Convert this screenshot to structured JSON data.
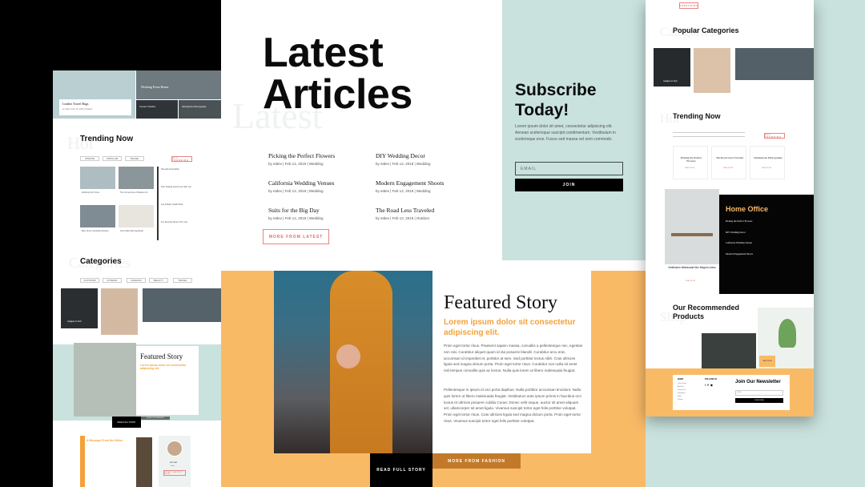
{
  "colors": {
    "background": "#000000",
    "mint": "#c9e2dd",
    "orange": "#f9ba66",
    "accent_text": "#f4a13a",
    "coral": "#e06b64",
    "dark": "#0b0b0b"
  },
  "center": {
    "title_line1": "Latest",
    "title_line2": "Articles",
    "ghost": "Latest",
    "articles": [
      {
        "title": "Picking the Perfect Flowers",
        "meta": "by etdev | Feb 12, 2019 | Wedding"
      },
      {
        "title": "DIY Wedding Decor",
        "meta": "by etdev | Feb 12, 2019 | Wedding"
      },
      {
        "title": "California Wedding Venues",
        "meta": "by etdev | Feb 12, 2019 | Wedding"
      },
      {
        "title": "Modern Engagement Shoots",
        "meta": "by etdev | Feb 12, 2019 | Wedding"
      },
      {
        "title": "Suits for the Big Day",
        "meta": "by etdev | Feb 12, 2019 | Wedding"
      },
      {
        "title": "The Road Less Traveled",
        "meta": "by etdev | Feb 12, 2019 | Outdoor"
      }
    ],
    "more_button": "MORE FROM LATEST"
  },
  "subscribe": {
    "title_line1": "Subscribe",
    "title_line2": "Today!",
    "body": "Lorem ipsum dolor sit amet, consectetur adipiscing elit. Aenean scelerisque suscipit condimentum. Vestibulum in scelerisque eros. Fusce sed massa vel sem commodo.",
    "email_placeholder": "EMAIL",
    "join": "JOIN"
  },
  "featured": {
    "title": "Featured Story",
    "subtitle": "Lorem ipsum dolor sit consectetur adipiscing elit.",
    "para1": "Proin eget tortor risus. Praesent sapien massa, convallis a pellentesque nec, egestas non nisi. Curabitur aliquet quam id dui posuere blandit. Curabitur arcu erat, accumsan id imperdiet et, porttitor at sem. Sed porttitor lectus nibh. Cras ultricies ligula sed magna dictum porta. Proin eget tortor risus. Curabitur non nulla sit amet nisl tempus convallis quis ac lectus. Nulla quis lorem ut libero malesuada feugiat.",
    "para2": "Pellentesque in ipsum id orci porta dapibus. Nulla porttitor accumsan tincidunt. Nulla quis lorem ut libero malesuada feugiat. Vestibulum ante ipsum primis in faucibus orci luctus et ultrices posuere cubilia Curae; Donec velit neque, auctor sit amet aliquam vel, ullamcorper sit amet ligula. Vivamus suscipit tortor eget felis porttitor volutpat. Proin eget tortor risus. Cras ultricies ligula sed magna dictum porta. Proin eget tortor risus. Vivamus suscipit tortor eget felis porttitor volutpat.",
    "read_button": "READ FULL STORY",
    "fashion_button": "MORE FROM FASHION"
  },
  "left": {
    "hero_card_title": "Leather Travel Bags",
    "hero_card_meta": "by etdev | Feb 12, 2019 | Outdoor",
    "hero_top_right": "Working From Home",
    "thumb1": "Sweater Weather",
    "thumb2": "Smartphone Photography",
    "trending_title": "Trending Now",
    "trending_ghost": "Hot",
    "chips": [
      "UPDATE",
      "POPULAR",
      "TRAVEL"
    ],
    "all_trending": "ALL TRENDING",
    "grid_items": [
      "Working from Home",
      "The Cornerstone of Modern Art",
      "Best Green Smoothie Recipes",
      "Life's Daily Morning Ritual"
    ],
    "list_items": [
      "Strength & Flexibility",
      "How Healing Foods Can Help You",
      "Gut & Brain Health Work",
      "Fun Running Shoes This Year"
    ],
    "categories_title": "Categories",
    "categories_ghost": "Categories",
    "cat_chips": [
      "OUTDOOR",
      "FITNESS",
      "FASHION",
      "BEAUTY",
      "TRAVEL"
    ],
    "cat_card_label": "Gadgets & Tech",
    "featured_title": "Featured Story",
    "featured_sub": "Lorem ipsum dolor sit consectetur adipiscing elit.",
    "read_btn": "READ FULL STORY",
    "fashion_btn": "MORE FROM FASHION",
    "message_title": "A Message From the Editor",
    "author_name": "Ann Gio",
    "author_role": "Editor",
    "about_btn": "READ ABOUT ANN"
  },
  "right": {
    "top_tag": "SUBSCRIBE",
    "categories_title": "Popular Categories",
    "categories_ghost": "Categories",
    "cat_label": "Gadgets & Tech",
    "trending_title": "Trending Now",
    "trending_ghost": "Hot",
    "all_trending": "ALL TRENDING",
    "trending_items": [
      "Picking the Perfect Flowers",
      "The Road Less Traveled",
      "Smartphone Photography"
    ],
    "read_more": "READ MORE",
    "office_title": "Home Office",
    "office_items": [
      "Picking the Perfect Flowers",
      "DIY Wedding Decor",
      "California Wedding Venues",
      "Modern Engagement Shoots"
    ],
    "office_caption": "Vestibulum Malesuada Nec Magna Lectus",
    "office_read": "READ MORE",
    "recommended_title_line1": "Our Recommended",
    "recommended_title_line2": "Products",
    "shop_now": "SHOP NOW",
    "footer_col1": "SHOP",
    "footer_col2": "FOLLOW US",
    "newsletter_title": "Join Our Newsletter",
    "newsletter_placeholder": "EMAIL",
    "newsletter_button": "SUBSCRIBE",
    "footer_links": [
      "Latest Posts",
      "About Us",
      "Contact Us",
      "Categories",
      "Shop",
      "Privacy"
    ]
  }
}
